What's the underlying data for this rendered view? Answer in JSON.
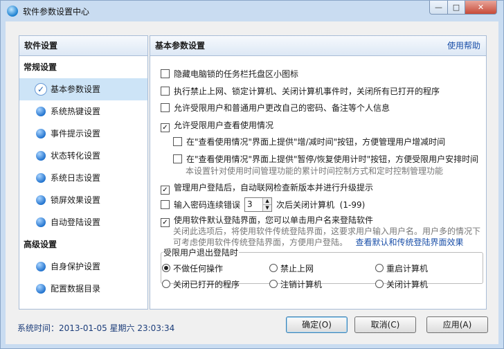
{
  "window": {
    "title": "软件参数设置中心",
    "minimize_glyph": "—",
    "maximize_glyph": "□",
    "close_glyph": "✕"
  },
  "sidebar": {
    "header": "软件设置",
    "groups": [
      {
        "label": "常规设置"
      },
      {
        "label": "高级设置"
      }
    ],
    "items": [
      {
        "label": "基本参数设置",
        "icon": "check-circle-icon",
        "selected": true
      },
      {
        "label": "系统热键设置",
        "icon": "blue-bullet-icon"
      },
      {
        "label": "事件提示设置",
        "icon": "blue-bullet-icon"
      },
      {
        "label": "状态转化设置",
        "icon": "blue-bullet-icon"
      },
      {
        "label": "系统日志设置",
        "icon": "blue-bullet-icon"
      },
      {
        "label": "锁屏效果设置",
        "icon": "blue-bullet-icon"
      },
      {
        "label": "自动登陆设置",
        "icon": "blue-bullet-icon"
      },
      {
        "label": "自身保护设置",
        "icon": "blue-bullet-icon"
      },
      {
        "label": "配置数据目录",
        "icon": "blue-bullet-icon"
      }
    ]
  },
  "panel": {
    "title": "基本参数设置",
    "help_link": "使用帮助",
    "options": [
      {
        "label": "隐藏电脑锁的任务栏托盘区小图标",
        "checked": false
      },
      {
        "label": "执行禁止上网、锁定计算机、关闭计算机事件时，关闭所有已打开的程序",
        "checked": false
      },
      {
        "label": "允许受限用户和普通用户更改自己的密码、备注等个人信息",
        "checked": false
      },
      {
        "label": "允许受限用户查看使用情况",
        "checked": true
      },
      {
        "label": "在\"查看使用情况\"界面上提供\"增/减时间\"按钮，方便管理用户增减时间",
        "checked": false
      },
      {
        "label": "在\"查看使用情况\"界面上提供\"暂停/恢复使用计时\"按钮，方便受限用户安排时间",
        "checked": false
      },
      {
        "label": "管理用户登陆后，自动联网检查新版本并进行升级提示",
        "checked": true
      },
      {
        "label_before": "输入密码连续错误",
        "value": "3",
        "label_after": "次后关闭计算机",
        "range": "(1-99)",
        "checked": false
      },
      {
        "label": "使用软件默认登陆界面，您可以单击用户名来登陆软件",
        "checked": true
      }
    ],
    "note_timer": "本设置针对使用时间管理功能的累计时间控制方式和定时控制管理功能",
    "note_login_1": "关闭此选项后，将使用软件传统登陆界面，这要求用户输入用户名。用户多的情况下",
    "note_login_2": "可考虑使用软件传统登陆界面，方便用户登陆。",
    "note_login_link": "查看默认和传统登陆界面效果",
    "logout_group": {
      "legend": "受限用户退出登陆时",
      "radios": [
        {
          "label": "不做任何操作",
          "selected": true
        },
        {
          "label": "禁止上网",
          "selected": false
        },
        {
          "label": "重启计算机",
          "selected": false
        },
        {
          "label": "关闭已打开的程序",
          "selected": false
        },
        {
          "label": "注销计算机",
          "selected": false
        },
        {
          "label": "关闭计算机",
          "selected": false
        }
      ]
    }
  },
  "footer": {
    "status": "系统时间：2013-01-05  星期六  23:03:34",
    "ok": "确定(O)",
    "cancel": "取消(C)",
    "apply": "应用(A)"
  }
}
